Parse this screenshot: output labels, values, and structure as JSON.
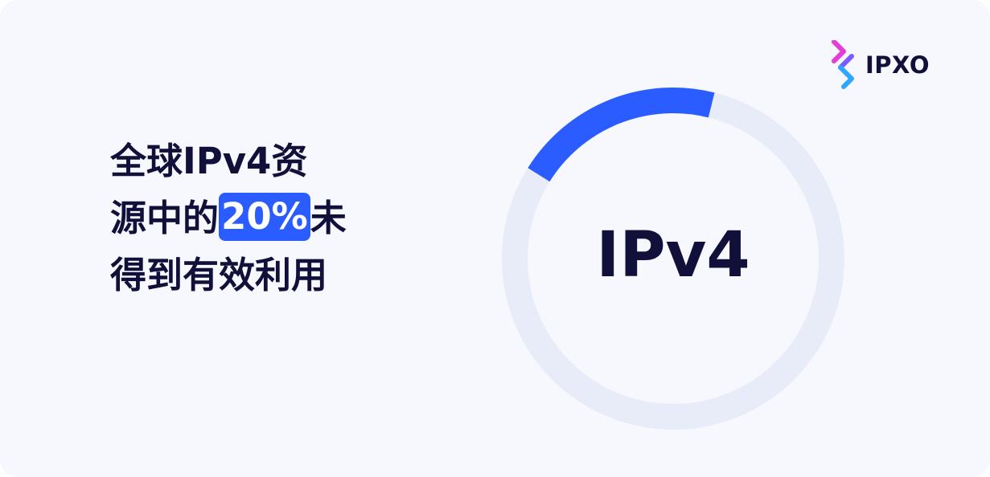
{
  "headline": {
    "line1": "全球IPv4资",
    "line2_prefix": "源中的",
    "line2_highlight": "20%",
    "line2_suffix": "未",
    "line3": "得到有效利用"
  },
  "logo": {
    "text": "IPXO",
    "icon": "ipxo-chevron-logo-icon"
  },
  "colors": {
    "background": "#f7f8fd",
    "text": "#10103a",
    "accent": "#2a5cff",
    "track": "#e7ecf8",
    "logo_pink": "#e63bd6",
    "logo_blue": "#2fa6ff"
  },
  "chart_data": {
    "type": "pie",
    "variant": "donut",
    "center_label": "IPv4",
    "values": [
      20,
      80
    ],
    "colors": [
      "#2a5cff",
      "#e7ecf8"
    ]
  }
}
